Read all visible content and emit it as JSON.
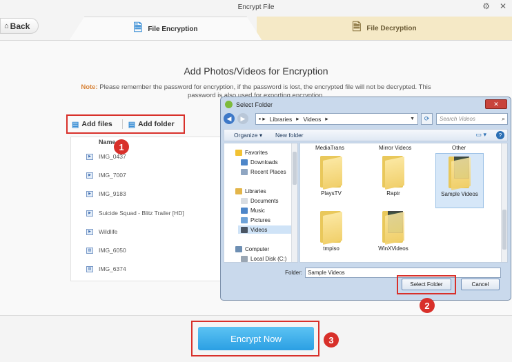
{
  "window": {
    "title": "Encrypt File"
  },
  "back": {
    "label": "Back"
  },
  "tabs": [
    {
      "label": "File Encryption",
      "active": true
    },
    {
      "label": "File Decryption",
      "active": false
    }
  ],
  "main": {
    "heading": "Add Photos/Videos for Encryption",
    "note_label": "Note:",
    "note_text": "Please remember the password for encryption, if the password is lost, the encrypted file will not be decrypted. This password is also used for exporting encryption.",
    "add_files": "Add files",
    "add_folder": "Add folder",
    "list_header": "Name",
    "files": [
      "IMG_0437",
      "IMG_7007",
      "IMG_9183",
      "Suicide Squad - Blitz Trailer [HD]",
      "Wildlife",
      "IMG_6050",
      "IMG_6374"
    ],
    "encrypt_button": "Encrypt Now"
  },
  "badges": [
    "1",
    "2",
    "3"
  ],
  "dialog": {
    "title": "Select Folder",
    "path": [
      "Libraries",
      "Videos"
    ],
    "search_placeholder": "Search Videos",
    "toolbar": {
      "organize": "Organize ▾",
      "new_folder": "New folder"
    },
    "nav": {
      "favorites": "Favorites",
      "downloads": "Downloads",
      "recent": "Recent Places",
      "libraries": "Libraries",
      "documents": "Documents",
      "music": "Music",
      "pictures": "Pictures",
      "videos": "Videos",
      "computer": "Computer",
      "local_disk": "Local Disk (C:)"
    },
    "top_items": [
      "MediaTrans",
      "Mirror Videos",
      "Other"
    ],
    "folders": [
      "PlaysTV",
      "Raptr",
      "Sample Videos",
      "tmpiso",
      "WinXVideos"
    ],
    "folder_label": "Folder:",
    "folder_value": "Sample Videos",
    "select_button": "Select Folder",
    "cancel_button": "Cancel"
  },
  "colors": {
    "accent_blue": "#2b9fe3",
    "highlight_red": "#d8302a",
    "tab_gold": "#f5e9c6"
  }
}
